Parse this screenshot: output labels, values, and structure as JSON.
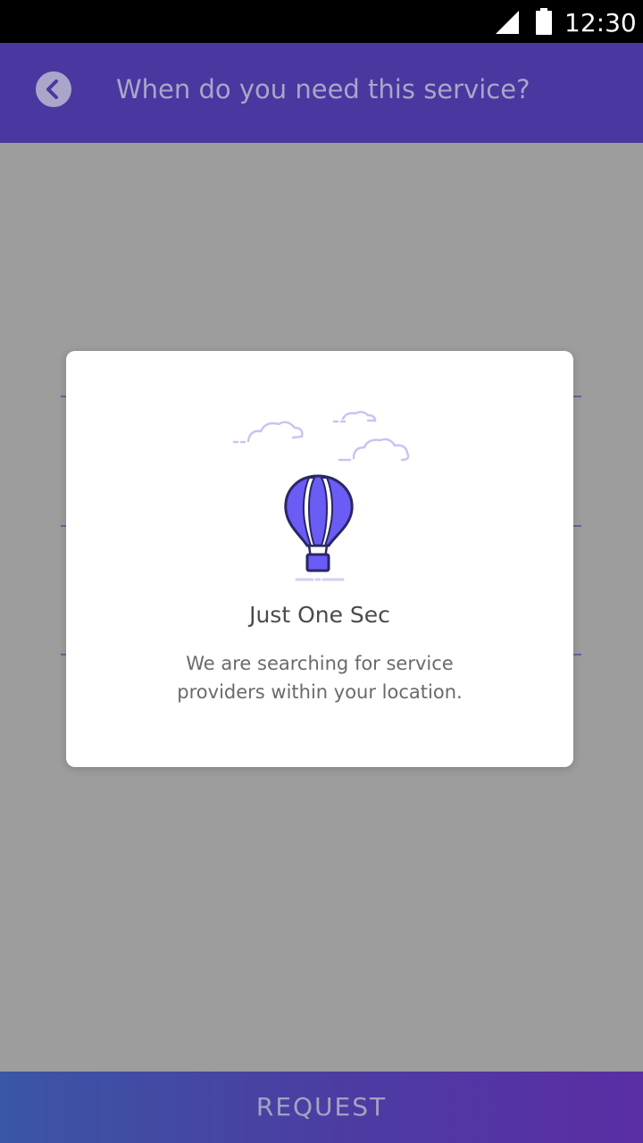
{
  "status_bar": {
    "time": "12:30",
    "signal_icon": "signal-icon",
    "battery_icon": "battery-icon"
  },
  "header": {
    "back_icon": "chevron-left-icon",
    "title": "When do you need this service?"
  },
  "modal": {
    "illustration_icon": "hot-air-balloon-icon",
    "title": "Just One Sec",
    "message": "We are searching for service providers within your location."
  },
  "footer": {
    "request_label": "REQUEST"
  },
  "colors": {
    "header_bg": "#4a37a0",
    "accent": "#6b5cf6",
    "overlay": "#9d9d9d"
  }
}
